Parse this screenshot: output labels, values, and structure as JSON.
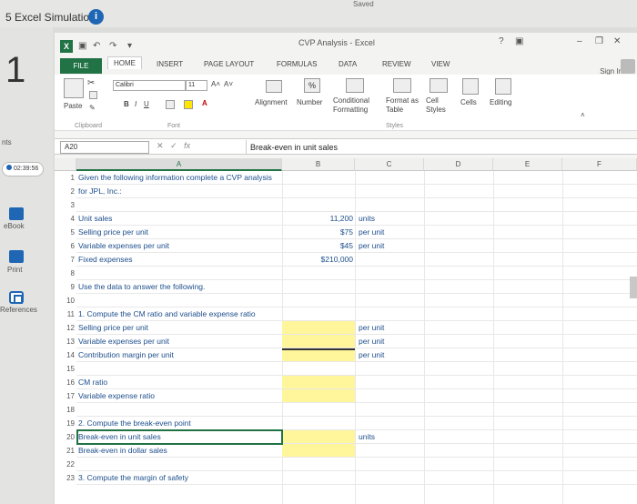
{
  "app": {
    "title": "5 Excel Simulation",
    "info_icon": "info-icon",
    "saved": "Saved",
    "question_number": "1"
  },
  "sidebar": {
    "top_label": "nts",
    "timer": "02:39:56",
    "items": [
      {
        "label": "eBook",
        "icon": "ebook-icon"
      },
      {
        "label": "Print",
        "icon": "print-icon"
      },
      {
        "label": "References",
        "icon": "references-icon"
      }
    ]
  },
  "excel": {
    "doc_title": "CVP Analysis - Excel",
    "window_controls": [
      "?",
      "▣",
      "–",
      "❐",
      "✕"
    ],
    "sign_in": "Sign In",
    "tabs": [
      "FILE",
      "HOME",
      "INSERT",
      "PAGE LAYOUT",
      "FORMULAS",
      "DATA",
      "REVIEW",
      "VIEW"
    ],
    "active_tab": "HOME",
    "ribbon": {
      "paste": "Paste",
      "font_name": "Calibri",
      "font_size": "11",
      "bold": "B",
      "italic": "I",
      "underline": "U",
      "alignment": "Alignment",
      "number": "Number",
      "percent": "%",
      "conditional_formatting": "Conditional Formatting",
      "format_as_table": "Format as Table",
      "cell_styles": "Cell Styles",
      "cells": "Cells",
      "editing": "Editing",
      "group_clipboard": "Clipboard",
      "group_font": "Font",
      "group_styles": "Styles"
    },
    "name_box": "A20",
    "formula": "Break-even in unit sales",
    "columns": [
      "A",
      "B",
      "C",
      "D",
      "E",
      "F"
    ],
    "rows": [
      {
        "n": "1",
        "a": "Given the following information complete a CVP analysis",
        "b": "",
        "c": ""
      },
      {
        "n": "2",
        "a": "for JPL, Inc.:",
        "b": "",
        "c": ""
      },
      {
        "n": "3",
        "a": "",
        "b": "",
        "c": ""
      },
      {
        "n": "4",
        "a": "Unit sales",
        "b": "11,200",
        "c": "units"
      },
      {
        "n": "5",
        "a": "Selling price per unit",
        "b": "$75",
        "c": "per unit"
      },
      {
        "n": "6",
        "a": "Variable expenses per unit",
        "b": "$45",
        "c": "per unit"
      },
      {
        "n": "7",
        "a": "Fixed expenses",
        "b": "$210,000",
        "c": ""
      },
      {
        "n": "8",
        "a": "",
        "b": "",
        "c": ""
      },
      {
        "n": "9",
        "a": "Use the data to answer the following.",
        "b": "",
        "c": ""
      },
      {
        "n": "10",
        "a": "",
        "b": "",
        "c": ""
      },
      {
        "n": "11",
        "a": "1. Compute the CM ratio and variable expense ratio",
        "b": "",
        "c": ""
      },
      {
        "n": "12",
        "a": "Selling price per unit",
        "b": "",
        "c": "per unit"
      },
      {
        "n": "13",
        "a": "Variable expenses per unit",
        "b": "",
        "c": "per unit"
      },
      {
        "n": "14",
        "a": "Contribution margin per unit",
        "b": "",
        "c": "per unit"
      },
      {
        "n": "15",
        "a": "",
        "b": "",
        "c": ""
      },
      {
        "n": "16",
        "a": "CM ratio",
        "b": "",
        "c": ""
      },
      {
        "n": "17",
        "a": "Variable expense ratio",
        "b": "",
        "c": ""
      },
      {
        "n": "18",
        "a": "",
        "b": "",
        "c": ""
      },
      {
        "n": "19",
        "a": "2. Compute the break-even point",
        "b": "",
        "c": ""
      },
      {
        "n": "20",
        "a": "Break-even in unit sales",
        "b": "",
        "c": "units"
      },
      {
        "n": "21",
        "a": "Break-even in dollar sales",
        "b": "",
        "c": ""
      },
      {
        "n": "22",
        "a": "",
        "b": "",
        "c": ""
      },
      {
        "n": "23",
        "a": "3. Compute the margin of safety",
        "b": "",
        "c": ""
      }
    ],
    "highlight_color": "#fff59a",
    "accent": "#217346"
  }
}
